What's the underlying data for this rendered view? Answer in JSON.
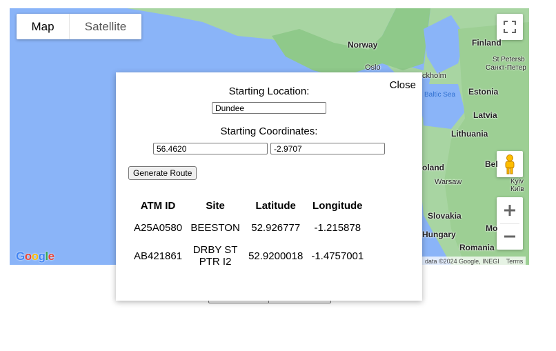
{
  "map": {
    "type_buttons": {
      "map": "Map",
      "satellite": "Satellite"
    },
    "labels": {
      "norway": "Norway",
      "finland": "Finland",
      "st_petersburg": "St Petersb",
      "st_petersburg_ru": "Санкт-Петер",
      "oslo": "Oslo",
      "stockholm": "ckholm",
      "baltic_sea": "Baltic Sea",
      "estonia": "Estonia",
      "latvia": "Latvia",
      "lithuania": "Lithuania",
      "poland": "oland",
      "warsaw": "Warsaw",
      "belarus": "Bel",
      "kyiv": "Kyiv",
      "kyiv_ua": "Київ",
      "slovakia": "Slovakia",
      "hungary": "Hungary",
      "romania": "Romania",
      "moldova": "Mo"
    },
    "google_logo": "Google",
    "attribution": {
      "data": "data ©2024 Google, INEGI",
      "terms": "Terms"
    },
    "colors": {
      "water": "#8ab4f8",
      "land": "#a8d5a2",
      "forest": "#8fc98a"
    }
  },
  "modal": {
    "close_label": "Close",
    "starting_location_label": "Starting Location:",
    "starting_location_value": "Dundee",
    "starting_coordinates_label": "Starting Coordinates:",
    "latitude_value": "56.4620",
    "longitude_value": "-2.9707",
    "generate_button": "Generate Route",
    "table": {
      "headers": [
        "ATM ID",
        "Site",
        "Latitude",
        "Longitude"
      ],
      "rows": [
        [
          "A25A0580",
          "BEESTON",
          "52.926777",
          "-1.215878"
        ],
        [
          "AB421861",
          "DRBY ST PTR I2",
          "52.9200018",
          "-1.4757001"
        ]
      ]
    }
  }
}
